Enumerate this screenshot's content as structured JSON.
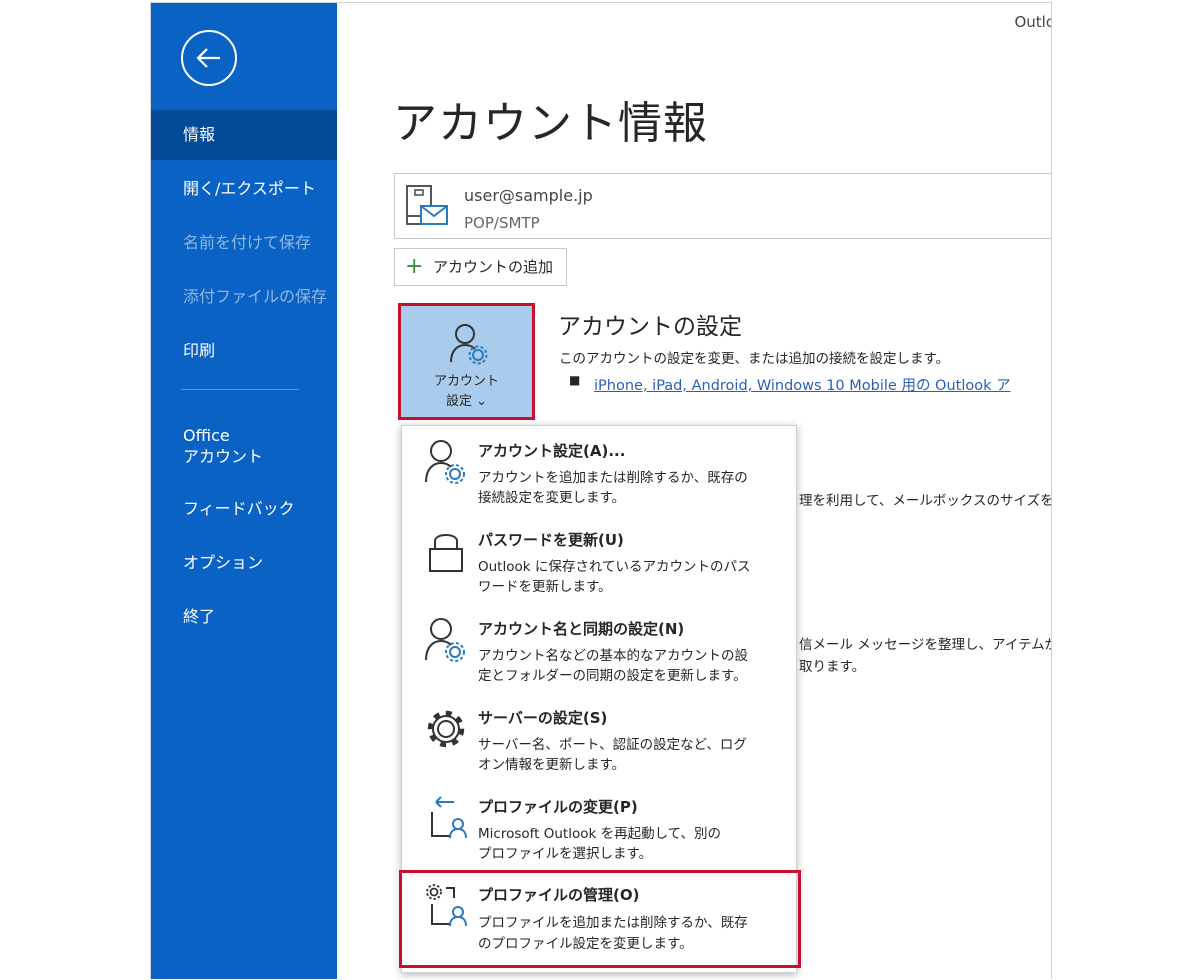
{
  "window": {
    "app_label": "Outlo"
  },
  "sidebar": {
    "items": [
      {
        "label": "情報",
        "state": "selected"
      },
      {
        "label": "開く/エクスポート",
        "state": "normal"
      },
      {
        "label": "名前を付けて保存",
        "state": "disabled"
      },
      {
        "label": "添付ファイルの保存",
        "state": "disabled"
      },
      {
        "label": "印刷",
        "state": "normal"
      },
      {
        "label": "Office",
        "label2": "アカウント",
        "state": "normal"
      },
      {
        "label": "フィードバック",
        "state": "normal"
      },
      {
        "label": "オプション",
        "state": "normal"
      },
      {
        "label": "終了",
        "state": "normal"
      }
    ]
  },
  "main": {
    "title": "アカウント情報",
    "account": {
      "email": "user@sample.jp",
      "type": "POP/SMTP"
    },
    "add_account_label": "アカウントの追加",
    "account_settings_button": {
      "line1": "アカウント",
      "line2": "設定 ⌄"
    },
    "section": {
      "heading": "アカウントの設定",
      "description": "このアカウントの設定を変更、または追加の接続を設定します。",
      "bullet": "■",
      "link": "iPhone, iPad, Android, Windows 10 Mobile 用の Outlook ア"
    },
    "background_text": {
      "line1": "理を利用して、メールボックスのサイズを",
      "line2": "信メール メッセージを整理し、アイテムが",
      "line3": "取ります。"
    }
  },
  "dropdown": {
    "items": [
      {
        "icon": "person-gear-icon",
        "title": "アカウント設定(A)...",
        "desc1": "アカウントを追加または削除するか、既存の",
        "desc2": "接続設定を変更します。"
      },
      {
        "icon": "lock-icon",
        "title": "パスワードを更新(U)",
        "desc1": "Outlook に保存されているアカウントのパス",
        "desc2": "ワードを更新します。"
      },
      {
        "icon": "person-gear-icon",
        "title": "アカウント名と同期の設定(N)",
        "desc1": "アカウント名などの基本的なアカウントの設",
        "desc2": "定とフォルダーの同期の設定を更新します。"
      },
      {
        "icon": "gear-icon",
        "title": "サーバーの設定(S)",
        "desc1": "サーバー名、ポート、認証の設定など、ログ",
        "desc2": "オン情報を更新します。"
      },
      {
        "icon": "profile-change-icon",
        "title": "プロファイルの変更(P)",
        "desc1": "Microsoft Outlook を再起動して、別の",
        "desc2": "プロファイルを選択します。"
      },
      {
        "icon": "profile-manage-icon",
        "title": "プロファイルの管理(O)",
        "desc1": "プロファイルを追加または削除するか、既存",
        "desc2": "のプロファイル設定を変更します。"
      }
    ]
  },
  "colors": {
    "sidebar_bg": "#0a63c4",
    "sidebar_selected": "#034b96",
    "highlight_red": "#c8102e",
    "link_blue": "#2b5fb8"
  }
}
